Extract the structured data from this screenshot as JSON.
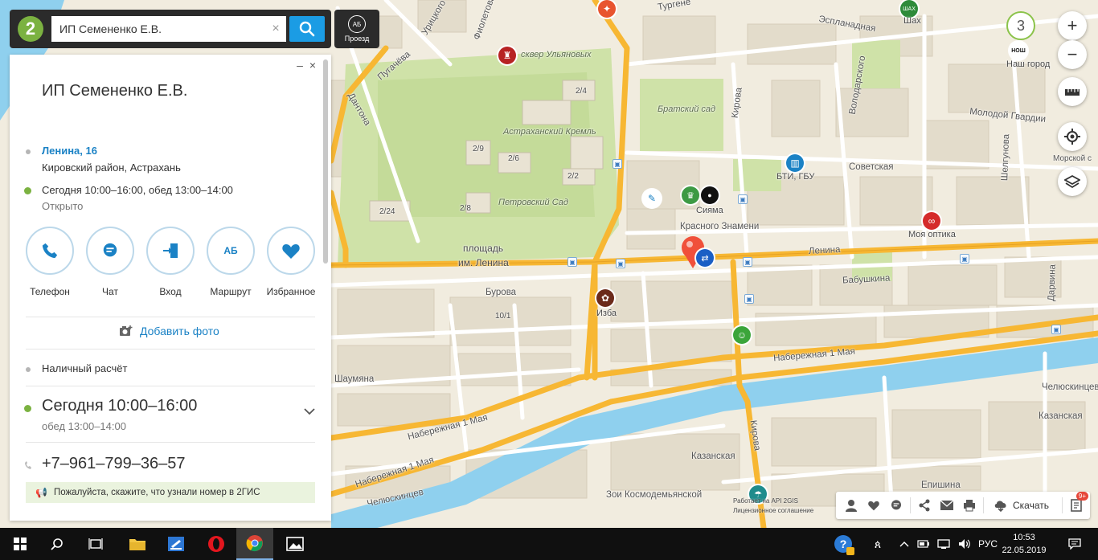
{
  "search": {
    "logo": "2",
    "value": "ИП Семененко Е.В.",
    "clear_label": "×",
    "route_label": "Проезд",
    "route_icon_text": "АБ"
  },
  "panel": {
    "minimize_label": "–",
    "close_label": "×",
    "title": "ИП Семененко Е.В.",
    "address": "Ленина, 16",
    "district": "Кировский район, Астрахань",
    "hours_short": "Сегодня 10:00–16:00, обед 13:00–14:00",
    "status": "Открыто",
    "actions": [
      {
        "label": "Телефон",
        "icon": "phone-icon"
      },
      {
        "label": "Чат",
        "icon": "chat-icon"
      },
      {
        "label": "Вход",
        "icon": "entrance-icon"
      },
      {
        "label": "Маршрут",
        "icon": "route-icon",
        "icon_text": "АБ"
      },
      {
        "label": "Избранное",
        "icon": "heart-icon"
      }
    ],
    "add_photo": "Добавить фото",
    "payment": "Наличный расчёт",
    "hours_big": "Сегодня 10:00–16:00",
    "lunch": "обед 13:00–14:00",
    "phone": "+7‒961‒799‒36‒57",
    "promo": "Пожалуйста, скажите, что узнали номер в 2ГИС"
  },
  "map": {
    "zoom_level": "3",
    "zoom_in": "+",
    "zoom_out": "−",
    "labels": {
      "kremlin_square": "сквер Ульяновых",
      "kremlin": "Астраханский Кремль",
      "petrovsky": "Петровский Сад",
      "lenin_square_1": "площадь",
      "lenin_square_2": "им. Ленина",
      "bratsky": "Братский сад",
      "buildings": [
        "2/4",
        "2/9",
        "2/6",
        "2/2",
        "2/8",
        "2/24",
        "10/1"
      ],
      "streets": {
        "esplanadnaya": "Эспланадная",
        "volodarskogo": "Володарского",
        "molodoy_gvardii": "Молодой Гвардии",
        "sovetskaya": "Советская",
        "kirova_top": "Кирова",
        "krasnogo_znameni": "Красного Знамени",
        "lenina": "Ленина",
        "babushkina": "Бабушкина",
        "burova": "Бурова",
        "naberezhnaya_1": "Набережная 1 Мая",
        "naberezhnaya_2": "Набережная 1 Мая",
        "naberezhnaya_3": "Набережная 1 Мая",
        "kirova_bottom": "Кирова",
        "kazanskaya_1": "Казанская",
        "kazanskaya_2": "Казанская",
        "chelyuskintsev_1": "Челюскинцев",
        "chelyuskintsev_2": "Челюскинцев",
        "shaumyana": "Шаумяна",
        "zoi": "Зои Космодемьянской",
        "epishina": "Епишина",
        "daryvina": "Дарвина",
        "sheltunova": "Шелгунова",
        "dantona": "Дантона",
        "pugacheva": "Пугачёва",
        "uritskogo": "Урицкого",
        "fioletova": "Фиолетова",
        "morskoy": "Морской с",
        "turgeneva": "Тургене"
      },
      "pois": {
        "siyama": "Сияма",
        "bti": "БТИ, ГБУ",
        "moya_optika": "Моя оптика",
        "izba": "Изба",
        "shakh": "Шах",
        "nash_gorod": "Наш город",
        "shakh_badge": "ШАХ",
        "nash_badge": "НОШ"
      }
    },
    "attribution_1": "Работает на API 2GIS",
    "attribution_2": "Лицензионное соглашение"
  },
  "toolbar": {
    "download_label": "Скачать",
    "notes_badge": "9+"
  },
  "taskbar": {
    "language": "РУС",
    "time": "10:53",
    "date": "22.05.2019"
  },
  "colors": {
    "brand_green": "#7bb241",
    "search_blue": "#1b9ce4",
    "link_blue": "#1b82c5",
    "road_orange": "#f7b733",
    "water": "#8fd0ee",
    "park": "#cfe2a8",
    "pin_red": "#f0503a"
  }
}
